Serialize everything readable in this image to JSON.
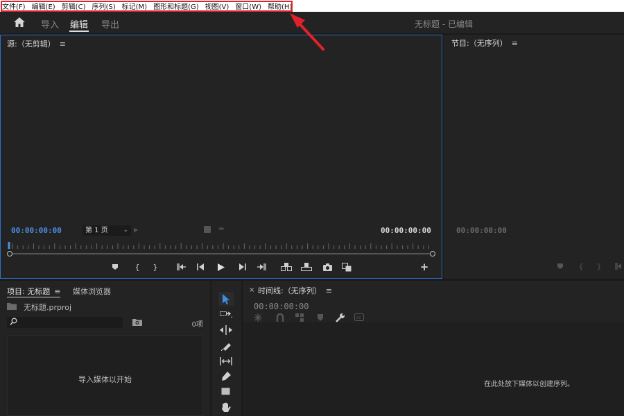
{
  "menu": {
    "items": [
      "文件(F)",
      "编辑(E)",
      "剪辑(C)",
      "序列(S)",
      "标记(M)",
      "图形和标题(G)",
      "视图(V)",
      "窗口(W)",
      "帮助(H)"
    ]
  },
  "header": {
    "tabs": [
      "导入",
      "编辑",
      "导出"
    ],
    "active_tab": "编辑",
    "document_title": "无标题 - 已编辑"
  },
  "source_monitor": {
    "title": "源:（无剪辑）",
    "menu_icon": "≡",
    "timecode_in": "00:00:00:00",
    "page_select": "第 1 页",
    "timecode_out": "00:00:00:00"
  },
  "program_monitor": {
    "title": "节目:（无序列）",
    "menu_icon": "≡",
    "timecode": "00:00:00:00"
  },
  "project": {
    "tab_project": "项目: 无标题",
    "tab_media_browser": "媒体浏览器",
    "menu_icon": "≡",
    "file_name": "无标题.prproj",
    "item_count": "0项",
    "empty_hint": "导入媒体以开始"
  },
  "timeline": {
    "close": "×",
    "title": "时间线:（无序列）",
    "menu_icon": "≡",
    "timecode": "00:00:00:00",
    "empty_hint": "在此处放下媒体以创建序列。"
  },
  "colors": {
    "accent_blue": "#4a90e2",
    "annotation_red": "#e0212b"
  },
  "icons": [
    "home-icon",
    "marker-icon",
    "mark-in-icon",
    "mark-out-icon",
    "go-to-in-icon",
    "step-back-icon",
    "play-icon",
    "step-forward-icon",
    "go-to-out-icon",
    "insert-icon",
    "overwrite-icon",
    "export-frame-icon",
    "compare-icon",
    "add-button-icon",
    "selection-tool-icon",
    "track-select-tool-icon",
    "ripple-edit-tool-icon",
    "razor-tool-icon",
    "slip-tool-icon",
    "pen-tool-icon",
    "rectangle-tool-icon",
    "hand-tool-icon"
  ]
}
